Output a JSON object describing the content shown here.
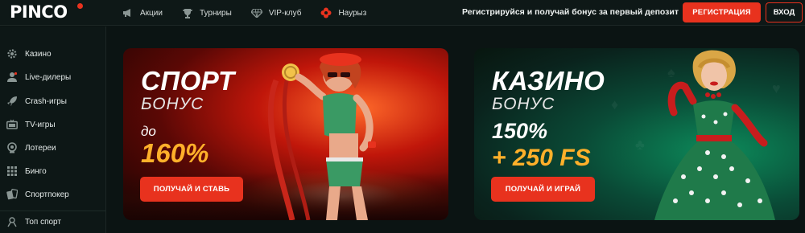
{
  "brand": {
    "logo": "PINCO"
  },
  "nav": [
    {
      "icon": "megaphone-icon",
      "label": "Акции"
    },
    {
      "icon": "trophy-icon",
      "label": "Турниры"
    },
    {
      "icon": "diamond-icon",
      "label": "VIP-клуб"
    },
    {
      "icon": "flower-icon",
      "label": "Наурыз"
    }
  ],
  "header": {
    "promo": "Регистрируйся и получай бонус за первый депозит",
    "register": "РЕГИСТРАЦИЯ",
    "login": "ВХОД"
  },
  "sidebar": [
    {
      "icon": "gear-icon",
      "label": "Казино"
    },
    {
      "icon": "live-dealer-icon",
      "label": "Live-дилеры"
    },
    {
      "icon": "rocket-icon",
      "label": "Crash-игры"
    },
    {
      "icon": "tv-icon",
      "label": "TV-игры"
    },
    {
      "icon": "lottery-ball-icon",
      "label": "Лотереи"
    },
    {
      "icon": "bingo-grid-icon",
      "label": "Бинго"
    },
    {
      "icon": "cards-icon",
      "label": "Спортпокер"
    },
    {
      "icon": "sport-icon",
      "label": "Топ спорт"
    }
  ],
  "banners": {
    "sport": {
      "title": "СПОРТ",
      "subtitle": "БОНУС",
      "pre": "до",
      "amount": "160%",
      "button": "ПОЛУЧАЙ И СТАВЬ"
    },
    "casino": {
      "title": "КАЗИНО",
      "subtitle": "БОНУС",
      "pre": "150%",
      "amount": "+ 250 FS",
      "button": "ПОЛУЧАЙ И ИГРАЙ"
    }
  },
  "colors": {
    "accent": "#e8321e",
    "gold": "#ffb02a",
    "background": "#0b1413"
  }
}
